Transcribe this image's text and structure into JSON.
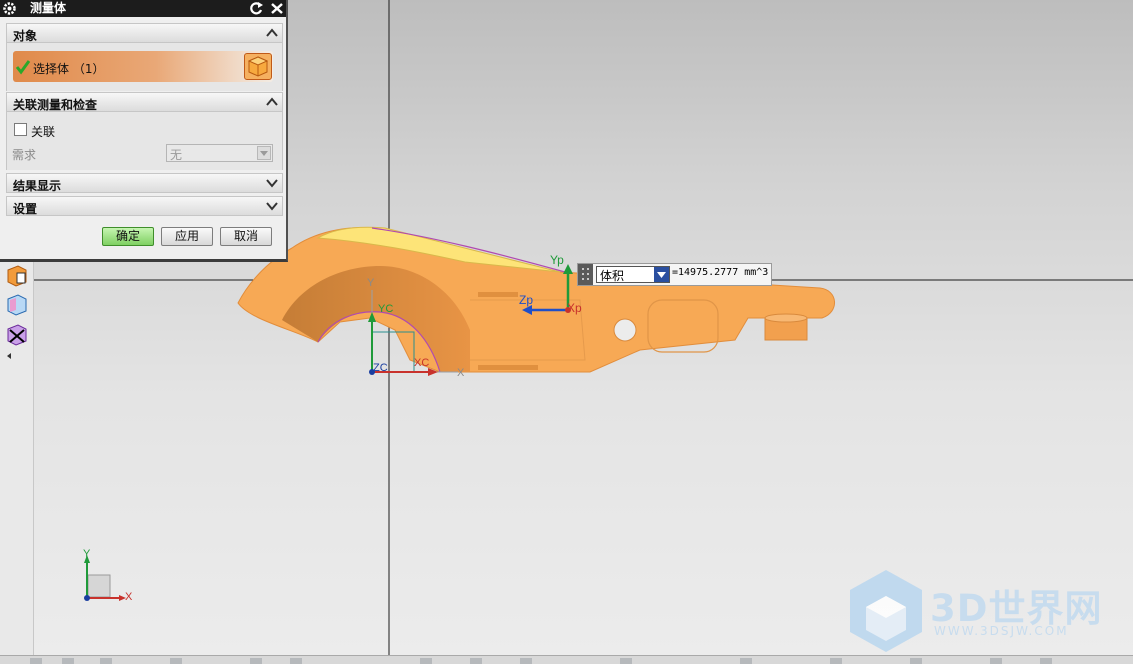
{
  "dialog": {
    "title": "测量体",
    "reset_icon": "reset-icon",
    "close_icon": "close-icon",
    "sections": {
      "object": {
        "label": "对象",
        "select_text": "选择体 （1）"
      },
      "assoc": {
        "label": "关联测量和检查",
        "checkbox_label": "关联",
        "requirement_label": "需求",
        "requirement_value": "无"
      },
      "results": {
        "label": "结果显示"
      },
      "settings": {
        "label": "设置"
      }
    },
    "buttons": {
      "ok": "确定",
      "apply": "应用",
      "cancel": "取消"
    }
  },
  "readout": {
    "type": "体积",
    "value": "=14975.2777 mm^3"
  },
  "axes": {
    "view": {
      "y": "Y",
      "x": "X",
      "zc": "ZC",
      "xc": "XC",
      "yc": "YC"
    },
    "part": {
      "yp": "Yp",
      "zp": "Zp",
      "xp": "Xp"
    },
    "triad": {
      "y": "Y",
      "x": "X"
    }
  },
  "watermark": {
    "brand": "3D世界网",
    "url": "WWW.3DSJW.COM"
  },
  "colors": {
    "part": "#f7a955",
    "part_dark": "#c47a30",
    "highlight": "#fde478",
    "ok_button": "#7fd062"
  }
}
